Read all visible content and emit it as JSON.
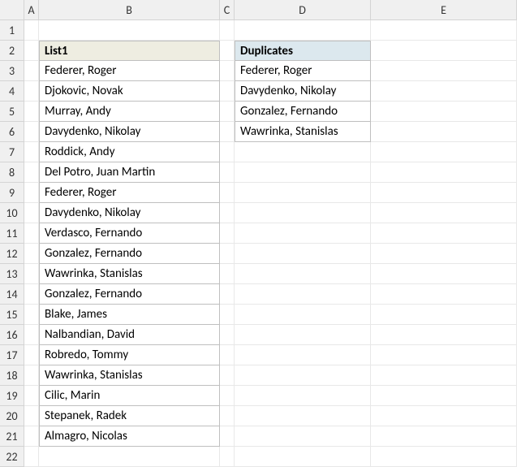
{
  "columns": [
    "A",
    "B",
    "C",
    "D",
    "E"
  ],
  "rowCount": 22,
  "list1": {
    "header": "List1",
    "items": [
      "Federer, Roger",
      "Djokovic, Novak",
      "Murray, Andy",
      "Davydenko, Nikolay",
      "Roddick, Andy",
      "Del Potro, Juan Martin",
      "Federer, Roger",
      "Davydenko, Nikolay",
      "Verdasco, Fernando",
      "Gonzalez, Fernando",
      "Wawrinka, Stanislas",
      "Gonzalez, Fernando",
      "Blake, James",
      "Nalbandian, David",
      "Robredo, Tommy",
      "Wawrinka, Stanislas",
      "Cilic, Marin",
      "Stepanek, Radek",
      "Almagro, Nicolas"
    ]
  },
  "duplicates": {
    "header": "Duplicates",
    "items": [
      "Federer, Roger",
      "Davydenko, Nikolay",
      "Gonzalez, Fernando",
      "Wawrinka, Stanislas"
    ]
  }
}
